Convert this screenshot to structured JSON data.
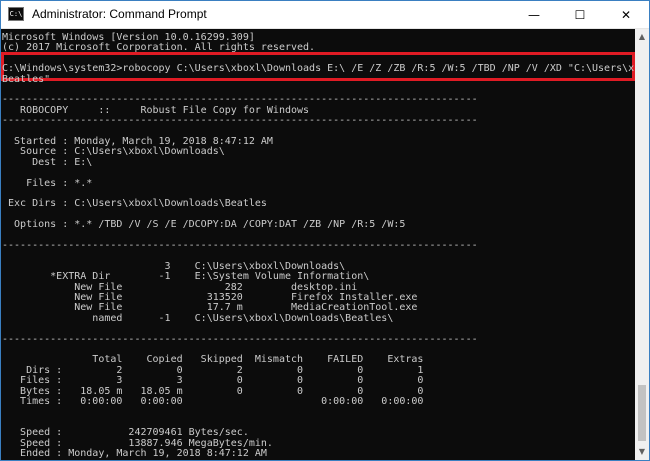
{
  "window": {
    "title": "Administrator: Command Prompt",
    "icon_label": "C:\\",
    "minimize_icon": "minimize-icon",
    "maximize_icon": "maximize-icon",
    "close_icon": "close-icon",
    "minimize_glyph": "—",
    "maximize_glyph": "☐",
    "close_glyph": "✕"
  },
  "scrollbar": {
    "up_glyph": "▲",
    "down_glyph": "▼"
  },
  "console": {
    "lines": [
      "Microsoft Windows [Version 10.0.16299.309]",
      "(c) 2017 Microsoft Corporation. All rights reserved.",
      "",
      "C:\\Windows\\system32>robocopy C:\\Users\\xboxl\\Downloads E:\\ /E /Z /ZB /R:5 /W:5 /TBD /NP /V /XD \"C:\\Users\\xboxl\\Downloads\\",
      "Beatles\"",
      "",
      "-------------------------------------------------------------------------------",
      "   ROBOCOPY     ::     Robust File Copy for Windows",
      "-------------------------------------------------------------------------------",
      "",
      "  Started : Monday, March 19, 2018 8:47:12 AM",
      "   Source : C:\\Users\\xboxl\\Downloads\\",
      "     Dest : E:\\",
      "",
      "    Files : *.*",
      "",
      " Exc Dirs : C:\\Users\\xboxl\\Downloads\\Beatles",
      "",
      "  Options : *.* /TBD /V /S /E /DCOPY:DA /COPY:DAT /ZB /NP /R:5 /W:5",
      "",
      "-------------------------------------------------------------------------------",
      "",
      "                           3    C:\\Users\\xboxl\\Downloads\\",
      "        *EXTRA Dir        -1    E:\\System Volume Information\\",
      "            New File                 282        desktop.ini",
      "            New File              313520        Firefox Installer.exe",
      "            New File              17.7 m        MediaCreationTool.exe",
      "               named      -1    C:\\Users\\xboxl\\Downloads\\Beatles\\",
      "",
      "-------------------------------------------------------------------------------",
      "",
      "               Total    Copied   Skipped  Mismatch    FAILED    Extras",
      "    Dirs :         2         0         2         0         0         1",
      "   Files :         3         3         0         0         0         0",
      "   Bytes :   18.05 m   18.05 m         0         0         0         0",
      "   Times :   0:00:00   0:00:00                       0:00:00   0:00:00",
      "",
      "",
      "   Speed :           242709461 Bytes/sec.",
      "   Speed :           13887.946 MegaBytes/min.",
      "   Ended : Monday, March 19, 2018 8:47:12 AM"
    ]
  },
  "colors": {
    "console_bg": "#0c0c0c",
    "console_text": "#cccccc",
    "highlight_border": "#e01b24",
    "title_bar_bg": "#ffffff",
    "window_border": "#3a7fc1"
  }
}
